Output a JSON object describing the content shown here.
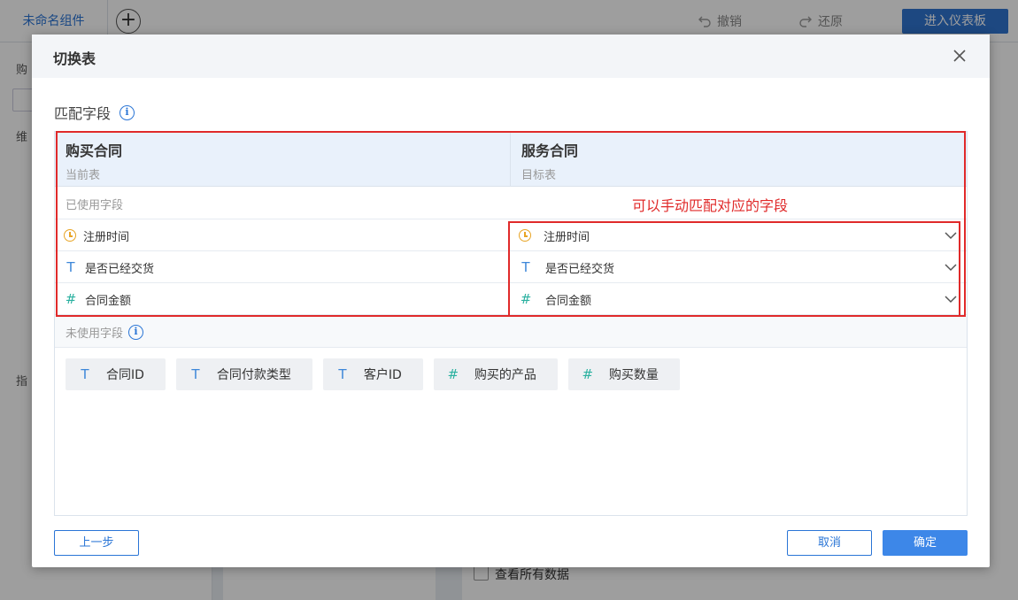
{
  "app": {
    "tab_name": "未命名组件",
    "tab_add_glyph": "+",
    "undo_label": "撤销",
    "redo_label": "还原",
    "enter_dashboard_label": "进入仪表板",
    "left_partial_labels": [
      "购",
      "维",
      "指"
    ],
    "right_checkbox_label": "查看所有数据"
  },
  "modal": {
    "title": "切换表",
    "section_title": "匹配字段",
    "info_glyph": "i",
    "current_table": {
      "name": "购买合同",
      "subtitle": "当前表"
    },
    "target_table": {
      "name": "服务合同",
      "subtitle": "目标表"
    },
    "used_fields_label": "已使用字段",
    "annotation": "可以手动匹配对应的字段",
    "field_rows": [
      {
        "icon": "clock-icon",
        "left": "注册时间",
        "right": "注册时间"
      },
      {
        "icon": "text-type-icon",
        "left": "是否已经交货",
        "right": "是否已经交货"
      },
      {
        "icon": "number-type-icon",
        "left": "合同金额",
        "right": "合同金额"
      }
    ],
    "unused_fields_label": "未使用字段",
    "unused_fields": [
      {
        "icon": "text-type-icon",
        "label": "合同ID"
      },
      {
        "icon": "text-type-icon",
        "label": "合同付款类型"
      },
      {
        "icon": "text-type-icon",
        "label": "客户ID"
      },
      {
        "icon": "number-type-icon",
        "label": "购买的产品"
      },
      {
        "icon": "number-type-icon",
        "label": "购买数量"
      }
    ],
    "prev_button": "上一步",
    "cancel_button": "取消",
    "confirm_button": "确定"
  },
  "colors": {
    "primary": "#3d87e8",
    "annotation_red": "#e02a2a",
    "clock_icon": "#e8a425",
    "text_icon": "#3d87d9",
    "number_icon": "#2bb1a0"
  }
}
